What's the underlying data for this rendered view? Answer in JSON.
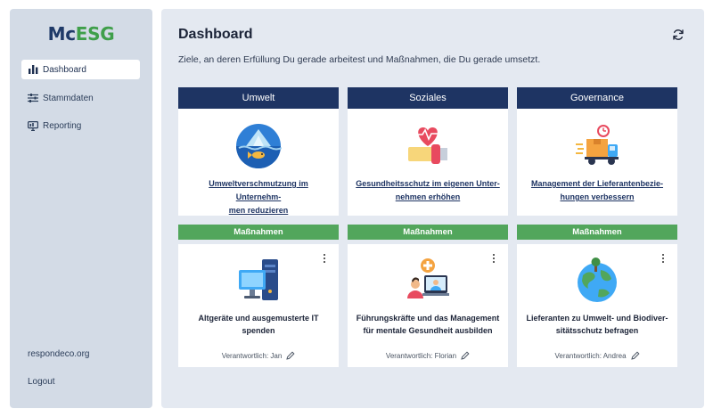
{
  "brand": {
    "logo_part1": "Mc",
    "logo_part2": "ESG"
  },
  "sidebar": {
    "items": [
      {
        "label": "Dashboard",
        "icon": "bar-chart-icon",
        "active": true
      },
      {
        "label": "Stammdaten",
        "icon": "sliders-icon",
        "active": false
      },
      {
        "label": "Reporting",
        "icon": "report-icon",
        "active": false
      }
    ],
    "website": "respondeco.org",
    "logout": "Logout"
  },
  "main": {
    "title": "Dashboard",
    "subtitle": "Ziele, an deren Erfüllung Du gerade arbeitest und Maßnahmen, die Du gerade umsetzt.",
    "refresh_icon": "refresh-icon",
    "columns": [
      {
        "category": "Umwelt",
        "goal": {
          "line1": "Umweltverschmutzung im Unternehm-",
          "line2": "men reduzieren",
          "icon": "polluted-water-icon"
        },
        "measures_label": "Maßnahmen",
        "measure": {
          "line1": "Altgeräte und ausgemusterte IT",
          "line2": "spenden",
          "icon": "computer-icon",
          "responsible": "Verantwortlich: Jan"
        }
      },
      {
        "category": "Soziales",
        "goal": {
          "line1": "Gesundheitsschutz im eigenen Unter-",
          "line2": "nehmen erhöhen",
          "icon": "heart-hand-icon"
        },
        "measures_label": "Maßnahmen",
        "measure": {
          "line1": "Führungskräfte und das Management",
          "line2": "für mentale Gesundheit ausbilden",
          "icon": "video-consultation-icon",
          "responsible": "Verantwortlich: Florian"
        }
      },
      {
        "category": "Governance",
        "goal": {
          "line1": "Management der Lieferantenbezie-",
          "line2": "hungen verbessern",
          "icon": "delivery-truck-icon"
        },
        "measures_label": "Maßnahmen",
        "measure": {
          "line1": "Lieferanten zu Umwelt- und Biodiver-",
          "line2": "sitätsschutz befragen",
          "icon": "earth-icon",
          "responsible": "Verantwortlich: Andrea"
        }
      }
    ]
  },
  "colors": {
    "navy": "#1e3463",
    "green": "#52a65c",
    "sidebar_bg": "#d3dbe6",
    "main_bg": "#e4e9f1"
  }
}
